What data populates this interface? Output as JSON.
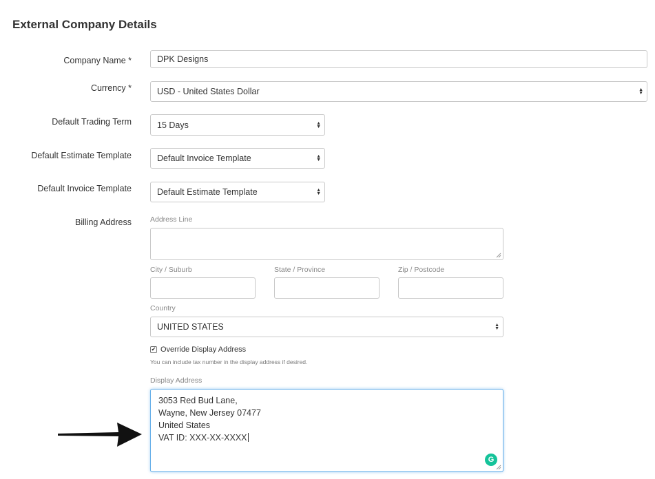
{
  "page": {
    "title": "External Company Details"
  },
  "form": {
    "company_name": {
      "label": "Company Name *",
      "value": "DPK Designs"
    },
    "currency": {
      "label": "Currency *",
      "value": "USD - United States Dollar"
    },
    "trading_term": {
      "label": "Default Trading Term",
      "value": "15 Days"
    },
    "estimate_template": {
      "label": "Default Estimate Template",
      "value": "Default Invoice Template"
    },
    "invoice_template": {
      "label": "Default Invoice Template",
      "value": "Default Estimate Template"
    },
    "billing": {
      "label": "Billing Address",
      "address_line_label": "Address Line",
      "address_line_value": "",
      "city_label": "City / Suburb",
      "city_value": "",
      "state_label": "State / Province",
      "state_value": "",
      "zip_label": "Zip / Postcode",
      "zip_value": "",
      "country_label": "Country",
      "country_value": "UNITED STATES",
      "override_label": "Override Display Address",
      "override_checked": true,
      "override_hint": "You can include tax number in the display address if desired.",
      "display_address_label": "Display Address",
      "display_address_lines": [
        "3053 Red Bud Lane,",
        "Wayne, New Jersey 07477",
        "United States",
        "VAT ID: XXX-XX-XXXX"
      ]
    }
  },
  "icons": {
    "grammarly": "grammarly-icon",
    "arrow": "arrow-pointer-icon",
    "select": "select-arrows-icon",
    "check": "checkmark-icon"
  },
  "colors": {
    "focus_border": "#66afe9",
    "grammarly": "#15c39a",
    "border": "#c8c8c8"
  }
}
